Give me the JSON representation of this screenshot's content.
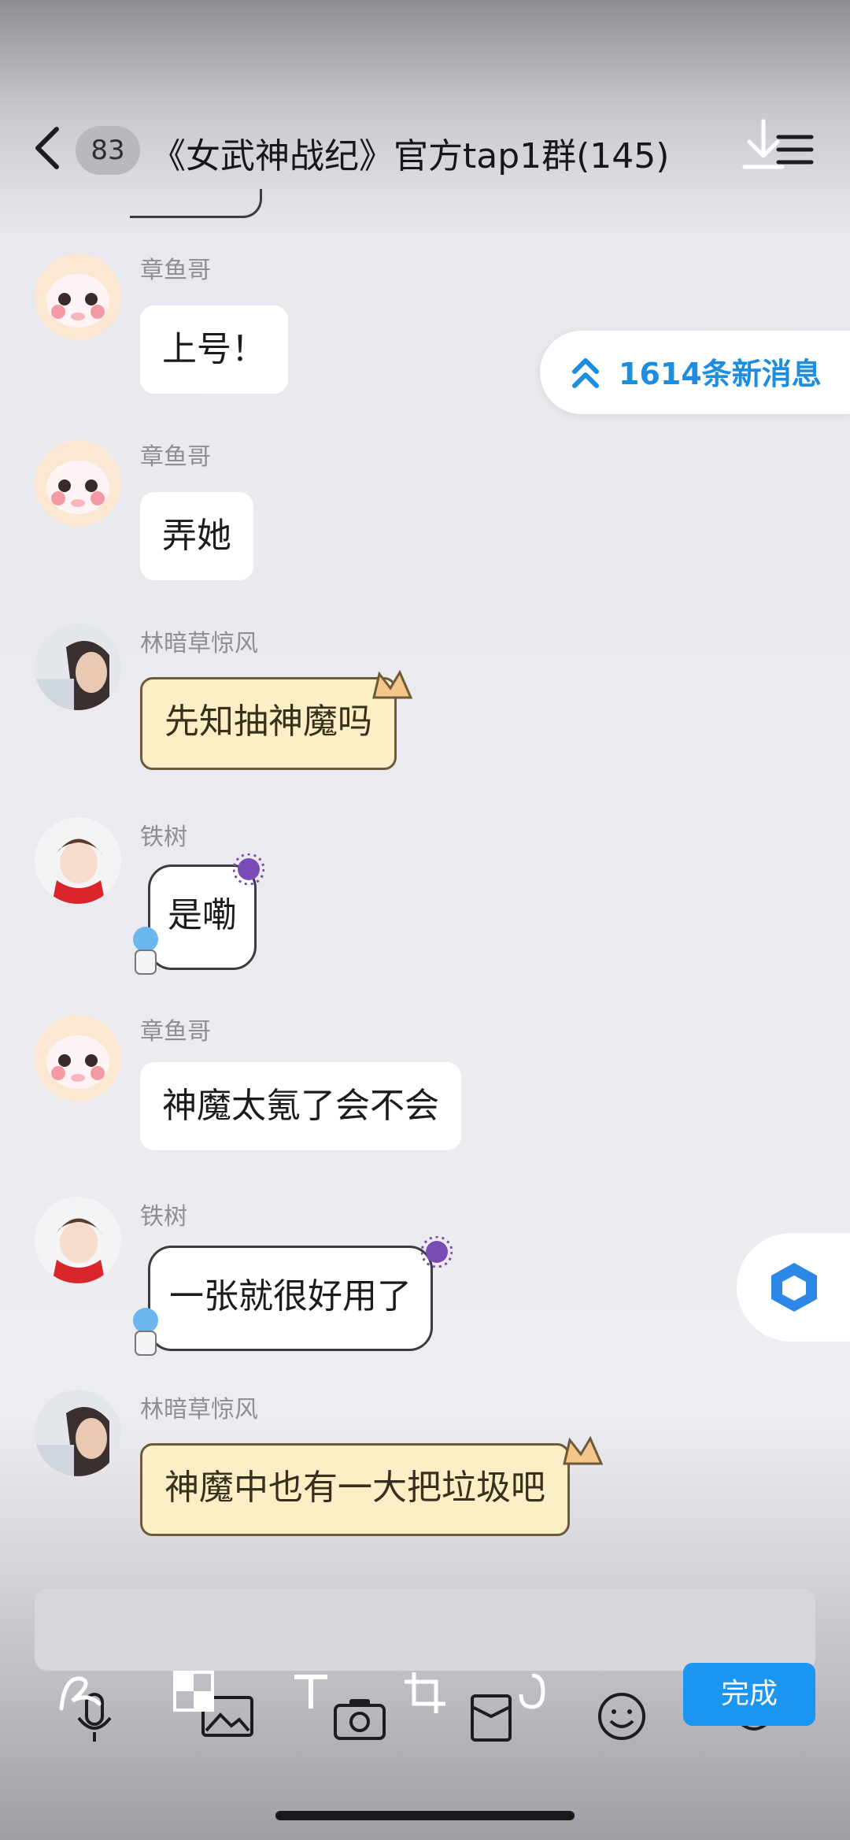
{
  "header": {
    "unread_count": "83",
    "title": "《女武神战纪》官方tap1群(145)"
  },
  "new_messages_pill": {
    "label": "1614条新消息"
  },
  "messages": [
    {
      "sender": "章鱼哥",
      "text": "上号！"
    },
    {
      "sender": "章鱼哥",
      "text": "弄她"
    },
    {
      "sender": "林暗草惊风",
      "text": "先知抽神魔吗"
    },
    {
      "sender": "铁树",
      "text": "是嘞"
    },
    {
      "sender": "章鱼哥",
      "text": "神魔太氪了会不会"
    },
    {
      "sender": "铁树",
      "text": "一张就很好用了"
    },
    {
      "sender": "林暗草惊风",
      "text": "神魔中也有一大把垃圾吧"
    }
  ],
  "editor": {
    "done_label": "完成"
  },
  "toolbar_icons": [
    "voice-icon",
    "image-icon",
    "camera-icon",
    "red-packet-icon",
    "emoji-icon",
    "more-icon"
  ],
  "edit_icons": [
    "doodle-icon",
    "mosaic-icon",
    "text-tool-icon",
    "crop-icon",
    "rotate-icon"
  ],
  "colors": {
    "accent": "#1b95f2",
    "new_msg_text": "#1d8de0",
    "cat_bubble": "#fbefc6"
  }
}
